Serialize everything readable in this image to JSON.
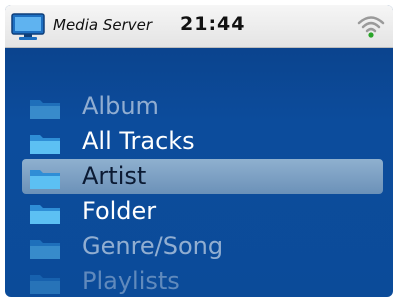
{
  "statusbar": {
    "icon": "computer-monitor-icon",
    "title": "Media Server",
    "time": "21:44",
    "wifi_icon": "wifi-icon"
  },
  "menu": {
    "items": [
      {
        "label": "Album",
        "icon": "folder-icon",
        "state": "dim"
      },
      {
        "label": "All Tracks",
        "icon": "folder-icon",
        "state": "normal"
      },
      {
        "label": "Artist",
        "icon": "folder-icon",
        "state": "selected"
      },
      {
        "label": "Folder",
        "icon": "folder-icon",
        "state": "normal"
      },
      {
        "label": "Genre/Song",
        "icon": "folder-icon",
        "state": "dim"
      },
      {
        "label": "Playlists",
        "icon": "folder-icon",
        "state": "dim2"
      }
    ]
  },
  "colors": {
    "background": "#0b4b99",
    "selection": "#7ea1c5",
    "statusbar": "#eeeeee",
    "folder": "#3aa6e8"
  }
}
